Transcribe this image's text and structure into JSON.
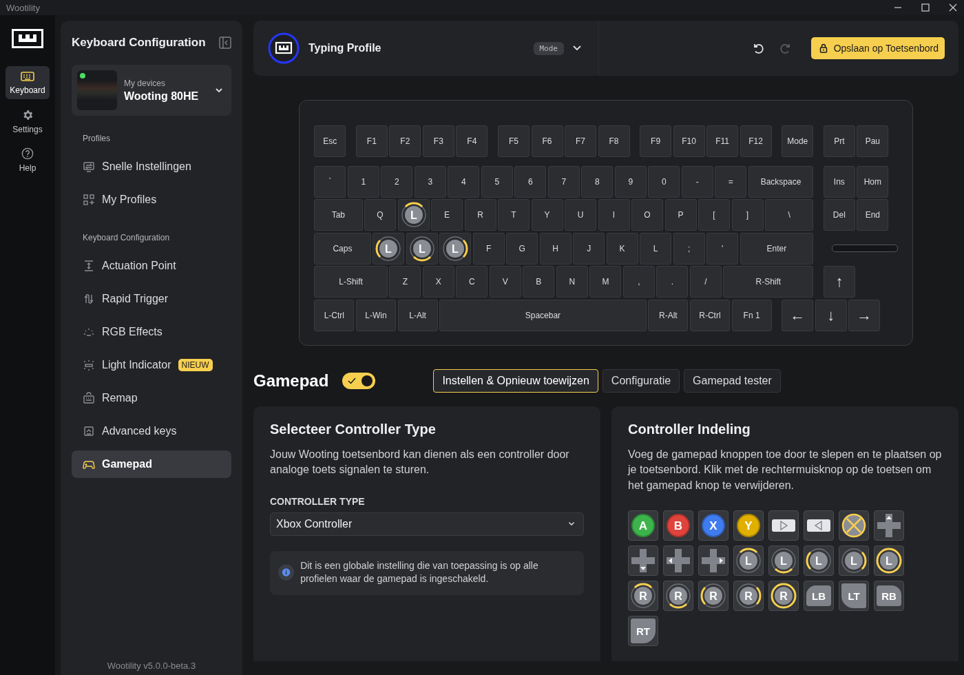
{
  "title_bar": {
    "title": "Wootility"
  },
  "rail": [
    {
      "label": "Keyboard",
      "selected": true
    },
    {
      "label": "Settings",
      "selected": false
    },
    {
      "label": "Help",
      "selected": false
    }
  ],
  "sidebar": {
    "title": "Keyboard Configuration",
    "device": {
      "caption": "My devices",
      "name": "Wooting 80HE",
      "connected": true
    },
    "sections": [
      {
        "heading": "Profiles",
        "items": [
          {
            "label": "Snelle Instellingen",
            "selected": false
          },
          {
            "label": "My Profiles",
            "selected": false
          }
        ]
      },
      {
        "heading": "Keyboard Configuration",
        "items": [
          {
            "label": "Actuation Point",
            "selected": false
          },
          {
            "label": "Rapid Trigger",
            "selected": false
          },
          {
            "label": "RGB Effects",
            "selected": false
          },
          {
            "label": "Light Indicator",
            "badge": "NIEUW",
            "selected": false
          },
          {
            "label": "Remap",
            "selected": false
          },
          {
            "label": "Advanced keys",
            "selected": false
          },
          {
            "label": "Gamepad",
            "selected": true
          }
        ]
      }
    ],
    "version": "Wootility v5.0.0-beta.3"
  },
  "header": {
    "profile": "Typing Profile",
    "mode": "Mode",
    "undo": {
      "disabled": false
    },
    "redo": {
      "disabled": true
    },
    "save_button": "Opslaan op Toetsenbord"
  },
  "keyboard": {
    "rows": [
      {
        "keys": [
          {
            "kind": "key",
            "label": "Esc"
          },
          {
            "kind": "key",
            "label": "F1"
          },
          {
            "kind": "key",
            "label": "F2"
          },
          {
            "kind": "key",
            "label": "F3"
          },
          {
            "kind": "key",
            "label": "F4"
          },
          {
            "kind": "key",
            "label": "F5"
          },
          {
            "kind": "key",
            "label": "F6"
          },
          {
            "kind": "key",
            "label": "F7"
          },
          {
            "kind": "key",
            "label": "F8"
          },
          {
            "kind": "key",
            "label": "F9"
          },
          {
            "kind": "key",
            "label": "F10"
          },
          {
            "kind": "key",
            "label": "F11"
          },
          {
            "kind": "key",
            "label": "F12"
          },
          {
            "kind": "key",
            "label": "Mode"
          },
          {
            "kind": "key",
            "label": "Prt"
          },
          {
            "kind": "key",
            "label": "Pau"
          }
        ]
      },
      {
        "keys": [
          {
            "kind": "key",
            "label": "`"
          },
          {
            "kind": "key",
            "label": "1"
          },
          {
            "kind": "key",
            "label": "2"
          },
          {
            "kind": "key",
            "label": "3"
          },
          {
            "kind": "key",
            "label": "4"
          },
          {
            "kind": "key",
            "label": "5"
          },
          {
            "kind": "key",
            "label": "6"
          },
          {
            "kind": "key",
            "label": "7"
          },
          {
            "kind": "key",
            "label": "8"
          },
          {
            "kind": "key",
            "label": "9"
          },
          {
            "kind": "key",
            "label": "0"
          },
          {
            "kind": "key",
            "label": "-"
          },
          {
            "kind": "key",
            "label": "="
          },
          {
            "kind": "key",
            "label": "Backspace"
          },
          {
            "kind": "key",
            "label": "Ins"
          },
          {
            "kind": "key",
            "label": "Hom"
          }
        ]
      },
      {
        "keys": [
          {
            "kind": "key",
            "label": "Tab"
          },
          {
            "kind": "key",
            "label": "Q"
          },
          {
            "kind": "stick_up",
            "label": "L"
          },
          {
            "kind": "key",
            "label": "E"
          },
          {
            "kind": "key",
            "label": "R"
          },
          {
            "kind": "key",
            "label": "T"
          },
          {
            "kind": "key",
            "label": "Y"
          },
          {
            "kind": "key",
            "label": "U"
          },
          {
            "kind": "key",
            "label": "I"
          },
          {
            "kind": "key",
            "label": "O"
          },
          {
            "kind": "key",
            "label": "P"
          },
          {
            "kind": "key",
            "label": "["
          },
          {
            "kind": "key",
            "label": "]"
          },
          {
            "kind": "key",
            "label": "\\"
          },
          {
            "kind": "key",
            "label": "Del"
          },
          {
            "kind": "key",
            "label": "End"
          }
        ]
      },
      {
        "keys": [
          {
            "kind": "key",
            "label": "Caps"
          },
          {
            "kind": "stick_left",
            "label": "L"
          },
          {
            "kind": "stick_down",
            "label": "L"
          },
          {
            "kind": "stick_right",
            "label": "L"
          },
          {
            "kind": "key",
            "label": "F"
          },
          {
            "kind": "key",
            "label": "G"
          },
          {
            "kind": "key",
            "label": "H"
          },
          {
            "kind": "key",
            "label": "J"
          },
          {
            "kind": "key",
            "label": "K"
          },
          {
            "kind": "key",
            "label": "L"
          },
          {
            "kind": "key",
            "label": ";"
          },
          {
            "kind": "key",
            "label": "'"
          },
          {
            "kind": "key",
            "label": "Enter"
          }
        ]
      },
      {
        "keys": [
          {
            "kind": "key",
            "label": "L-Shift"
          },
          {
            "kind": "key",
            "label": "Z"
          },
          {
            "kind": "key",
            "label": "X"
          },
          {
            "kind": "key",
            "label": "C"
          },
          {
            "kind": "key",
            "label": "V"
          },
          {
            "kind": "key",
            "label": "B"
          },
          {
            "kind": "key",
            "label": "N"
          },
          {
            "kind": "key",
            "label": "M"
          },
          {
            "kind": "key",
            "label": ","
          },
          {
            "kind": "key",
            "label": "."
          },
          {
            "kind": "key",
            "label": "/"
          },
          {
            "kind": "key",
            "label": "R-Shift"
          },
          {
            "kind": "arrow",
            "label": "↑"
          }
        ]
      },
      {
        "keys": [
          {
            "kind": "key",
            "label": "L-Ctrl"
          },
          {
            "kind": "key",
            "label": "L-Win"
          },
          {
            "kind": "key",
            "label": "L-Alt"
          },
          {
            "kind": "key",
            "label": "Spacebar"
          },
          {
            "kind": "key",
            "label": "R-Alt"
          },
          {
            "kind": "key",
            "label": "R-Ctrl"
          },
          {
            "kind": "key",
            "label": "Fn 1"
          },
          {
            "kind": "arrow",
            "label": "←"
          },
          {
            "kind": "arrow",
            "label": "↓"
          },
          {
            "kind": "arrow",
            "label": "→"
          }
        ]
      }
    ]
  },
  "gamepad": {
    "title": "Gamepad",
    "enabled": true,
    "tabs": [
      {
        "label": "Instellen & Opnieuw toewijzen",
        "selected": true
      },
      {
        "label": "Configuratie",
        "selected": false
      },
      {
        "label": "Gamepad tester",
        "selected": false
      }
    ],
    "controller_type": {
      "title": "Selecteer Controller Type",
      "description": "Jouw Wooting toetsenbord kan dienen als een controller door analoge toets signalen te sturen.",
      "field_label": "CONTROLLER TYPE",
      "value": "Xbox Controller",
      "note": "Dit is een globale instelling die van toepassing is op alle profielen waar de gamepad is ingeschakeld."
    },
    "layout": {
      "title": "Controller Indeling",
      "description": "Voeg de gamepad knoppen toe door te slepen en te plaatsen op je toetsenbord. Klik met de rechtermuisknop op de toetsen om het gamepad knop te verwijderen.",
      "palette": [
        {
          "kind": "face",
          "label": "A",
          "color": "#3cb44b"
        },
        {
          "kind": "face",
          "label": "B",
          "color": "#e0433b"
        },
        {
          "kind": "face",
          "label": "X",
          "color": "#3f7cf0"
        },
        {
          "kind": "face",
          "label": "Y",
          "color": "#e1af00"
        },
        {
          "kind": "menu_right"
        },
        {
          "kind": "menu_left"
        },
        {
          "kind": "guide"
        },
        {
          "kind": "dpad_up"
        },
        {
          "kind": "dpad_down"
        },
        {
          "kind": "dpad_left"
        },
        {
          "kind": "dpad_right"
        },
        {
          "kind": "stick_up",
          "label": "L"
        },
        {
          "kind": "stick_down",
          "label": "L"
        },
        {
          "kind": "stick_left",
          "label": "L"
        },
        {
          "kind": "stick_right",
          "label": "L"
        },
        {
          "kind": "stick_full",
          "label": "L"
        },
        {
          "kind": "stick_up",
          "label": "R"
        },
        {
          "kind": "stick_down",
          "label": "R"
        },
        {
          "kind": "stick_left",
          "label": "R"
        },
        {
          "kind": "stick_right",
          "label": "R"
        },
        {
          "kind": "stick_full",
          "label": "R"
        },
        {
          "kind": "bumper_left",
          "label": "LB"
        },
        {
          "kind": "trigger_left",
          "label": "LT"
        },
        {
          "kind": "bumper_right",
          "label": "RB"
        },
        {
          "kind": "trigger_right",
          "label": "RT"
        }
      ]
    }
  }
}
